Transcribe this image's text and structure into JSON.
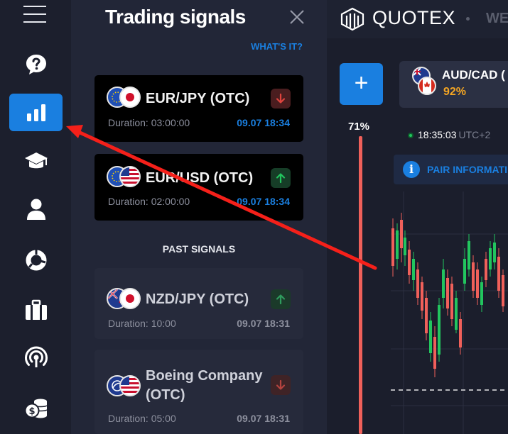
{
  "panel": {
    "title": "Trading signals",
    "whats_it": "WHAT'S IT?",
    "past_label": "PAST SIGNALS"
  },
  "signals": [
    {
      "pair": "EUR/JPY (OTC)",
      "duration": "Duration: 03:00:00",
      "time": "09.07 18:34",
      "direction": "down",
      "flags": [
        "eu",
        "jp"
      ]
    },
    {
      "pair": "EUR/USD (OTC)",
      "duration": "Duration: 02:00:00",
      "time": "09.07 18:34",
      "direction": "up",
      "flags": [
        "eu",
        "us"
      ]
    }
  ],
  "past_signals": [
    {
      "pair": "NZD/JPY (OTC)",
      "duration": "Duration: 10:00",
      "time": "09.07 18:31",
      "direction": "up",
      "flags": [
        "nz",
        "jp"
      ]
    },
    {
      "pair_line1": "Boeing Company",
      "pair_line2": "(OTC)",
      "duration": "Duration: 05:00",
      "time": "09.07 18:31",
      "direction": "down",
      "flags": [
        "boeing",
        "us"
      ]
    }
  ],
  "sidebar": {
    "items": [
      {
        "icon": "help-icon"
      },
      {
        "icon": "signals-icon",
        "active": true
      },
      {
        "icon": "education-icon"
      },
      {
        "icon": "profile-icon"
      },
      {
        "icon": "analytics-icon"
      },
      {
        "icon": "portfolio-icon"
      },
      {
        "icon": "broadcast-icon"
      },
      {
        "icon": "coins-icon"
      }
    ]
  },
  "header": {
    "brand": "QUOTEX",
    "truncated_tab": "WE"
  },
  "trade": {
    "asset_name": "AUD/CAD (",
    "asset_payout": "92%",
    "sentiment_pct": "71%",
    "clock_time": "18:35:03",
    "clock_tz": "UTC+2",
    "pair_info": "PAIR INFORMATI"
  },
  "colors": {
    "accent": "#1a7fe0",
    "up": "#22c55e",
    "down": "#f0605a",
    "payout": "#f5a623"
  }
}
